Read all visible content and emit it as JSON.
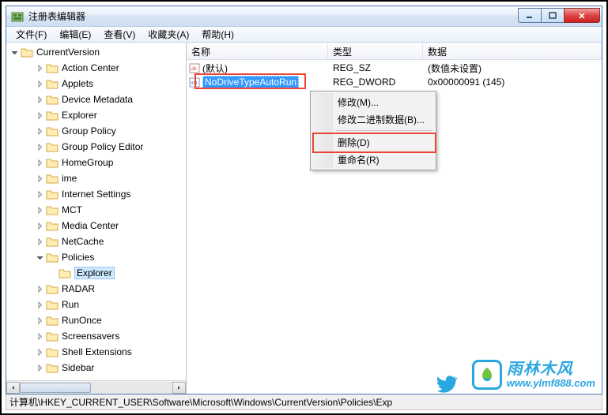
{
  "window": {
    "title": "注册表编辑器"
  },
  "menu": {
    "file": "文件(F)",
    "edit": "编辑(E)",
    "view": "查看(V)",
    "favorites": "收藏夹(A)",
    "help": "帮助(H)"
  },
  "tree": {
    "root": "CurrentVersion",
    "items": [
      {
        "label": "Action Center",
        "depth": 2,
        "exp": "closed"
      },
      {
        "label": "Applets",
        "depth": 2,
        "exp": "closed"
      },
      {
        "label": "Device Metadata",
        "depth": 2,
        "exp": "closed"
      },
      {
        "label": "Explorer",
        "depth": 2,
        "exp": "closed"
      },
      {
        "label": "Group Policy",
        "depth": 2,
        "exp": "closed"
      },
      {
        "label": "Group Policy Editor",
        "depth": 2,
        "exp": "closed"
      },
      {
        "label": "HomeGroup",
        "depth": 2,
        "exp": "closed"
      },
      {
        "label": "ime",
        "depth": 2,
        "exp": "closed"
      },
      {
        "label": "Internet Settings",
        "depth": 2,
        "exp": "closed"
      },
      {
        "label": "MCT",
        "depth": 2,
        "exp": "closed"
      },
      {
        "label": "Media Center",
        "depth": 2,
        "exp": "closed"
      },
      {
        "label": "NetCache",
        "depth": 2,
        "exp": "closed"
      },
      {
        "label": "Policies",
        "depth": 2,
        "exp": "open"
      },
      {
        "label": "Explorer",
        "depth": 3,
        "exp": "none",
        "selected": true
      },
      {
        "label": "RADAR",
        "depth": 2,
        "exp": "closed"
      },
      {
        "label": "Run",
        "depth": 2,
        "exp": "closed"
      },
      {
        "label": "RunOnce",
        "depth": 2,
        "exp": "closed"
      },
      {
        "label": "Screensavers",
        "depth": 2,
        "exp": "closed"
      },
      {
        "label": "Shell Extensions",
        "depth": 2,
        "exp": "closed"
      },
      {
        "label": "Sidebar",
        "depth": 2,
        "exp": "closed"
      }
    ]
  },
  "columns": {
    "name": "名称",
    "type": "类型",
    "data": "数据"
  },
  "values": [
    {
      "name": "(默认)",
      "type": "REG_SZ",
      "data": "(数值未设置)",
      "icon": "sz"
    },
    {
      "name": "NoDriveTypeAutoRun",
      "type": "REG_DWORD",
      "data": "0x00000091 (145)",
      "icon": "bin",
      "selected": true
    }
  ],
  "context_menu": {
    "modify": "修改(M)...",
    "modify_binary": "修改二进制数据(B)...",
    "delete": "删除(D)",
    "rename": "重命名(R)"
  },
  "statusbar": {
    "path": "计算机\\HKEY_CURRENT_USER\\Software\\Microsoft\\Windows\\CurrentVersion\\Policies\\Exp"
  },
  "watermark": {
    "cn": "雨林木风",
    "url": "www.ylmf888.com"
  }
}
